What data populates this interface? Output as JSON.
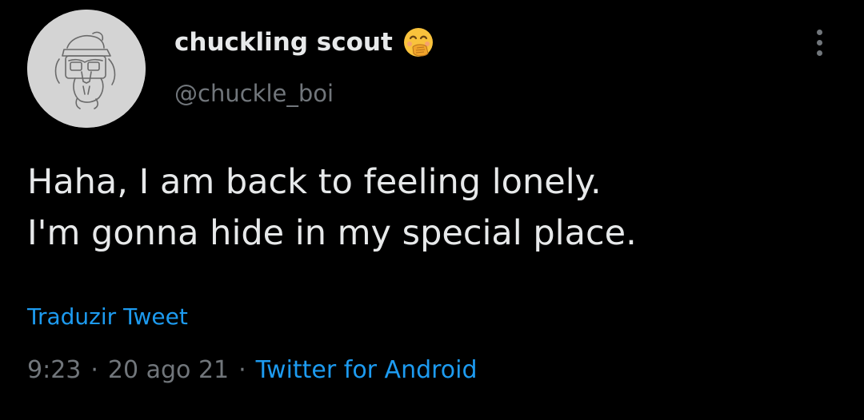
{
  "author": {
    "display_name": "chuckling scout",
    "handle": "@chuckle_boi",
    "avatar_icon": "sketch-avatar-icon",
    "badge_emoji_icon": "face-with-hand-over-mouth-emoji"
  },
  "tweet": {
    "text_lines": [
      "Haha, I am back to feeling lonely.",
      "I'm gonna hide in my special place."
    ],
    "translate_label": "Traduzir Tweet",
    "time": "9:23",
    "date": "20 ago 21",
    "separator": "·",
    "source": "Twitter for Android"
  },
  "menu": {
    "icon": "more-options-icon"
  },
  "colors": {
    "background": "#000000",
    "primary_text": "#e7e9ea",
    "secondary_text": "#71767b",
    "link": "#1d9bf0"
  }
}
